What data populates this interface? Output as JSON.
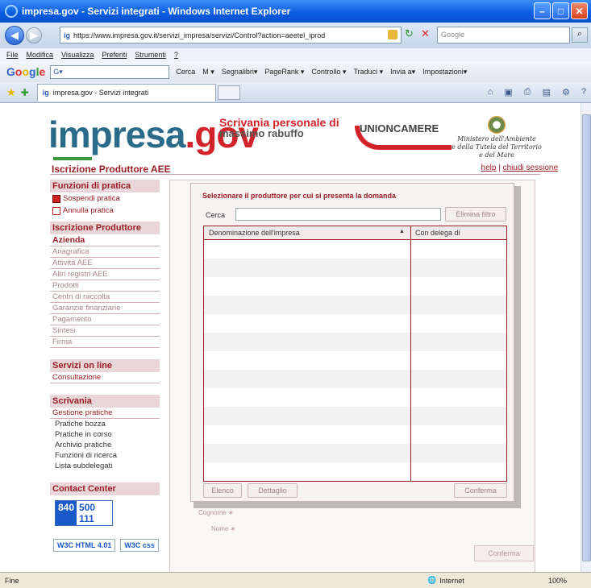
{
  "browser": {
    "title": "impresa.gov - Servizi integrati - Windows Internet Explorer",
    "url_favicon": "ig",
    "url": "https://www.impresa.gov.it/servizi_impresa/servizi/Control?action=aeetel_iprod",
    "search_placeholder": "Google",
    "menus": [
      "File",
      "Modifica",
      "Visualizza",
      "Preferiti",
      "Strumenti",
      "?"
    ],
    "google_toolbar": {
      "logo": "Google",
      "search_value": "G▾",
      "items": [
        "Cerca",
        "M ▾",
        "Segnalibri▾",
        "PageRank ▾",
        "Controllo ▾",
        "Traduci ▾",
        "Invia a▾",
        "Impostazioni▾"
      ]
    },
    "tab_title": "impresa.gov - Servizi integrati",
    "status_left": "Fine",
    "status_zone": "Internet",
    "status_zoom": "100%"
  },
  "header": {
    "logo_imp": "impresa",
    "logo_dot": ".",
    "logo_gov": "gov",
    "scrivania_line1": "Scrivania personale di",
    "scrivania_line2": "massimo rabuffo",
    "unioncamere": "UNIONCAMERE",
    "ministero_line1": "Ministero dell'Ambiente",
    "ministero_line2": "e della Tutela del Territorio e del Mare"
  },
  "page": {
    "section_title": "Iscrizione Produttore AEE",
    "help_link": "help",
    "separator": "|",
    "logout_link": "chiudi sessione"
  },
  "sidebar": {
    "funzioni_title": "Funzioni di pratica",
    "sospendi": "Sospendi pratica",
    "annulla": "Annulla pratica",
    "iscrizione_title": "Iscrizione Produttore",
    "azienda": "Azienda",
    "steps": [
      "Anagrafica",
      "Attività AEE",
      "Altri registri AEE",
      "Prodotti",
      "Centri di raccolta",
      "Garanzie finanziarie",
      "Pagamento",
      "Sintesi",
      "Firma"
    ],
    "servizi_title": "Servizi on line",
    "consultazione": "Consultazione",
    "scrivania_title": "Scrivania",
    "gestione": "Gestione pratiche",
    "pratiche": [
      "Pratiche bozza",
      "Pratiche in corso",
      "Archivio pratiche",
      "Funzioni di ricerca",
      "Lista subdelegati"
    ],
    "contact_title": "Contact Center",
    "contact_a": "840",
    "contact_b": "500 111",
    "w3c_html": "W3C HTML 4.01",
    "w3c_css": "W3C css"
  },
  "background_form": {
    "cognome_label": "Cognome ∗",
    "nome_label": "Nome ∗",
    "conferma": "Conferma"
  },
  "modal": {
    "title": "Selezionare il produttore per cui si presenta la domanda",
    "search_label": "Cerca",
    "search_value": "",
    "clear_filter": "Elimina filtro",
    "columns": [
      "Denominazione dell'impresa",
      "Con delega di"
    ],
    "sort_indicator": "▲",
    "btn_elenco": "Elenco",
    "btn_dettaglio": "Dettaglio",
    "btn_conferma": "Conferma"
  }
}
